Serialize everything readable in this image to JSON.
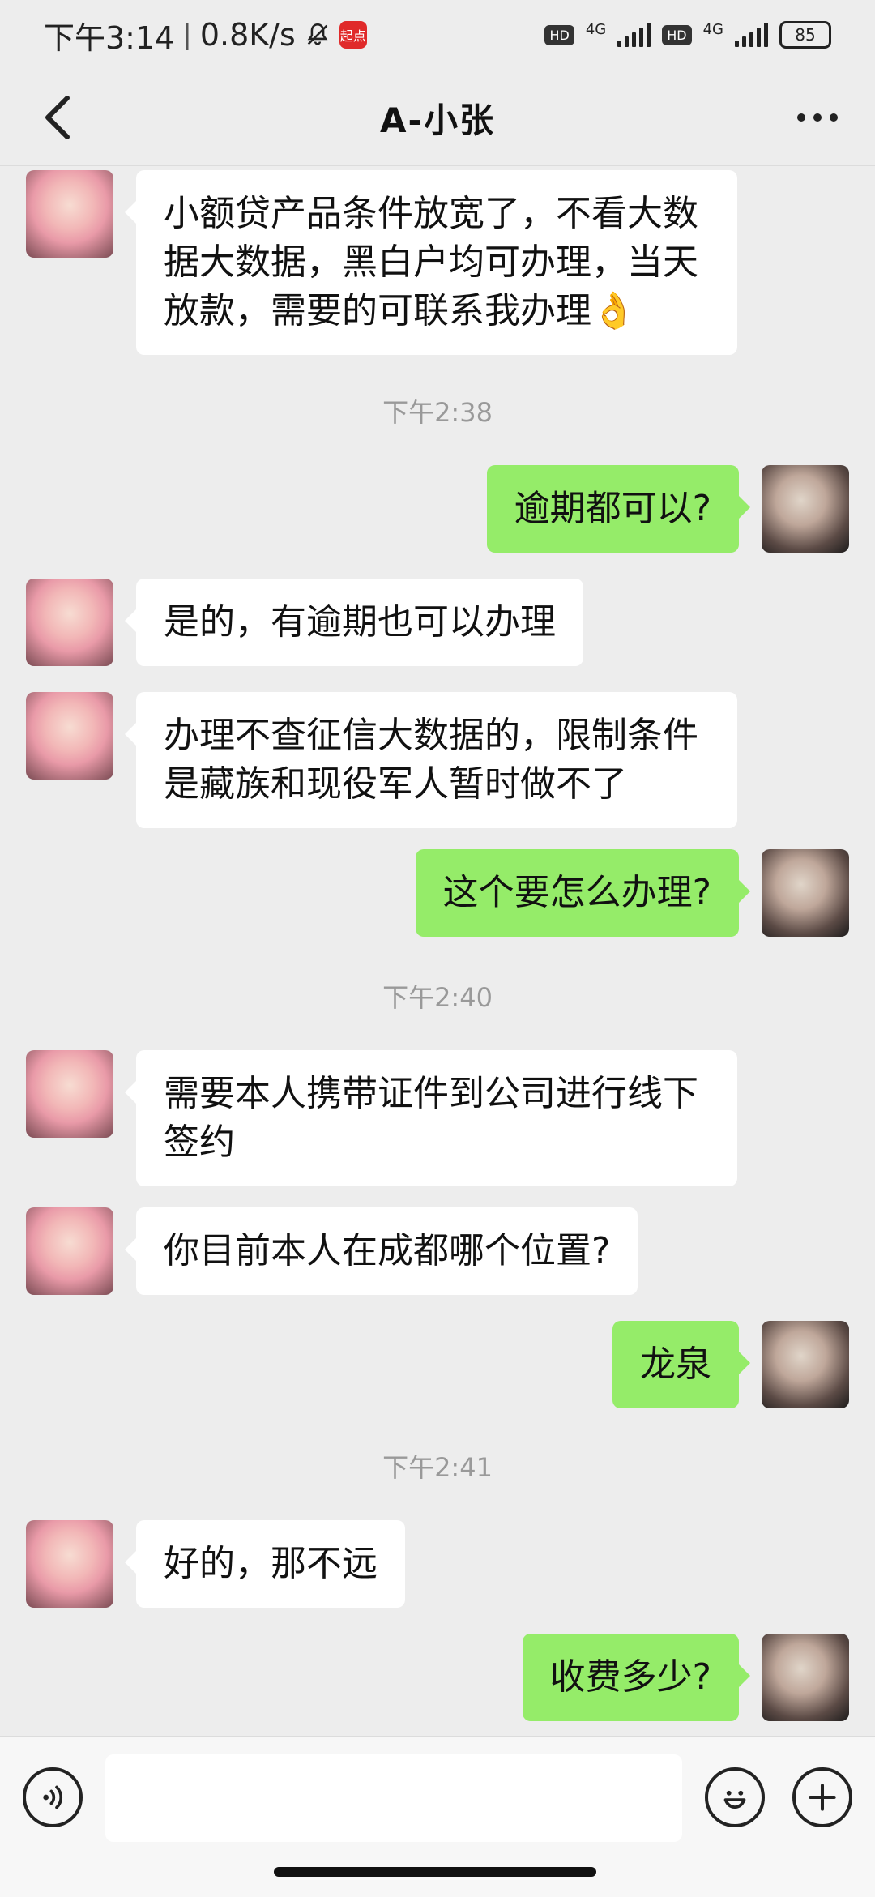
{
  "status_bar": {
    "time": "下午3:14",
    "speed": "0.8K/s",
    "app_badge": "起点",
    "hd1": "HD",
    "net1": "4G",
    "hd2": "HD",
    "net2": "4G",
    "battery": "85"
  },
  "header": {
    "title": "A-小张"
  },
  "messages": [
    {
      "dir": "in",
      "text": "小额贷产品条件放宽了，不看大数据大数据，黑白户均可办理，当天放款，需要的可联系我办理👌"
    },
    {
      "type": "time",
      "text": "下午2:38"
    },
    {
      "dir": "out",
      "text": "逾期都可以?"
    },
    {
      "dir": "in",
      "text": "是的，有逾期也可以办理"
    },
    {
      "dir": "in",
      "text": "办理不查征信大数据的，限制条件是藏族和现役军人暂时做不了"
    },
    {
      "dir": "out",
      "text": "这个要怎么办理?"
    },
    {
      "type": "time",
      "text": "下午2:40"
    },
    {
      "dir": "in",
      "text": "需要本人携带证件到公司进行线下签约"
    },
    {
      "dir": "in",
      "text": "你目前本人在成都哪个位置?"
    },
    {
      "dir": "out",
      "text": "龙泉"
    },
    {
      "type": "time",
      "text": "下午2:41"
    },
    {
      "dir": "in",
      "text": "好的，那不远"
    },
    {
      "dir": "out",
      "text": "收费多少?"
    }
  ],
  "input": {
    "value": "",
    "placeholder": ""
  },
  "icons": {
    "back": "back-arrow-icon",
    "more": "more-icon",
    "voice": "voice-icon",
    "emoji": "emoji-icon",
    "add": "add-icon"
  },
  "colors": {
    "background": "#EDEDED",
    "outgoing_bubble": "#95EC69",
    "incoming_bubble": "#FFFFFF"
  }
}
